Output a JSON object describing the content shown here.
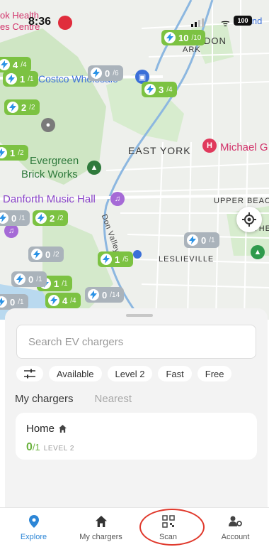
{
  "status_bar": {
    "time": "8:36",
    "battery": "100"
  },
  "map": {
    "places": {
      "health_centre_1": "ok Health",
      "health_centre_2": "es Centre",
      "band": "Band",
      "ark": "ARK",
      "don": "DON",
      "costco": "Costco Wholesale",
      "east_york": "EAST YORK",
      "michael": "Michael G",
      "evergreen_1": "Evergreen",
      "evergreen_2": "Brick Works",
      "danforth": "Danforth Music Hall",
      "upper_beach": "UPPER BEAC",
      "the": "THE",
      "don_valley": "Don Valley",
      "leslieville": "LESLIEVILLE"
    },
    "pins": [
      {
        "available": "10",
        "total": "/10",
        "color": "green"
      },
      {
        "available": "4",
        "total": "/4",
        "color": "green"
      },
      {
        "available": "1",
        "total": "/1",
        "color": "green"
      },
      {
        "available": "0",
        "total": "/6",
        "color": "gray"
      },
      {
        "available": "3",
        "total": "/4",
        "color": "green"
      },
      {
        "available": "2",
        "total": "/2",
        "color": "green"
      },
      {
        "available": "1",
        "total": "/2",
        "color": "green"
      },
      {
        "available": "0",
        "total": "/1",
        "color": "gray"
      },
      {
        "available": "2",
        "total": "/2",
        "color": "green"
      },
      {
        "available": "0",
        "total": "/2",
        "color": "gray"
      },
      {
        "available": "1",
        "total": "/5",
        "color": "green"
      },
      {
        "available": "0",
        "total": "/1",
        "color": "gray"
      },
      {
        "available": "1",
        "total": "/1",
        "color": "green"
      },
      {
        "available": "4",
        "total": "/4",
        "color": "green"
      },
      {
        "available": "0",
        "total": "/14",
        "color": "gray"
      },
      {
        "available": "0",
        "total": "/1",
        "color": "gray"
      },
      {
        "available": "0",
        "total": "/1",
        "color": "gray"
      }
    ]
  },
  "search": {
    "placeholder": "Search EV chargers"
  },
  "filters": {
    "chips": [
      "Available",
      "Level 2",
      "Fast",
      "Free"
    ]
  },
  "tabs": {
    "my_chargers": "My chargers",
    "nearest": "Nearest"
  },
  "card": {
    "title": "Home",
    "available": "0",
    "total": "/1",
    "level": "LEVEL 2"
  },
  "nav": {
    "explore": "Explore",
    "my_chargers": "My chargers",
    "scan": "Scan",
    "account": "Account"
  },
  "colors": {
    "brand_green": "#7cc242",
    "accent_blue": "#2d86d6",
    "highlight_red": "#e0392c"
  }
}
